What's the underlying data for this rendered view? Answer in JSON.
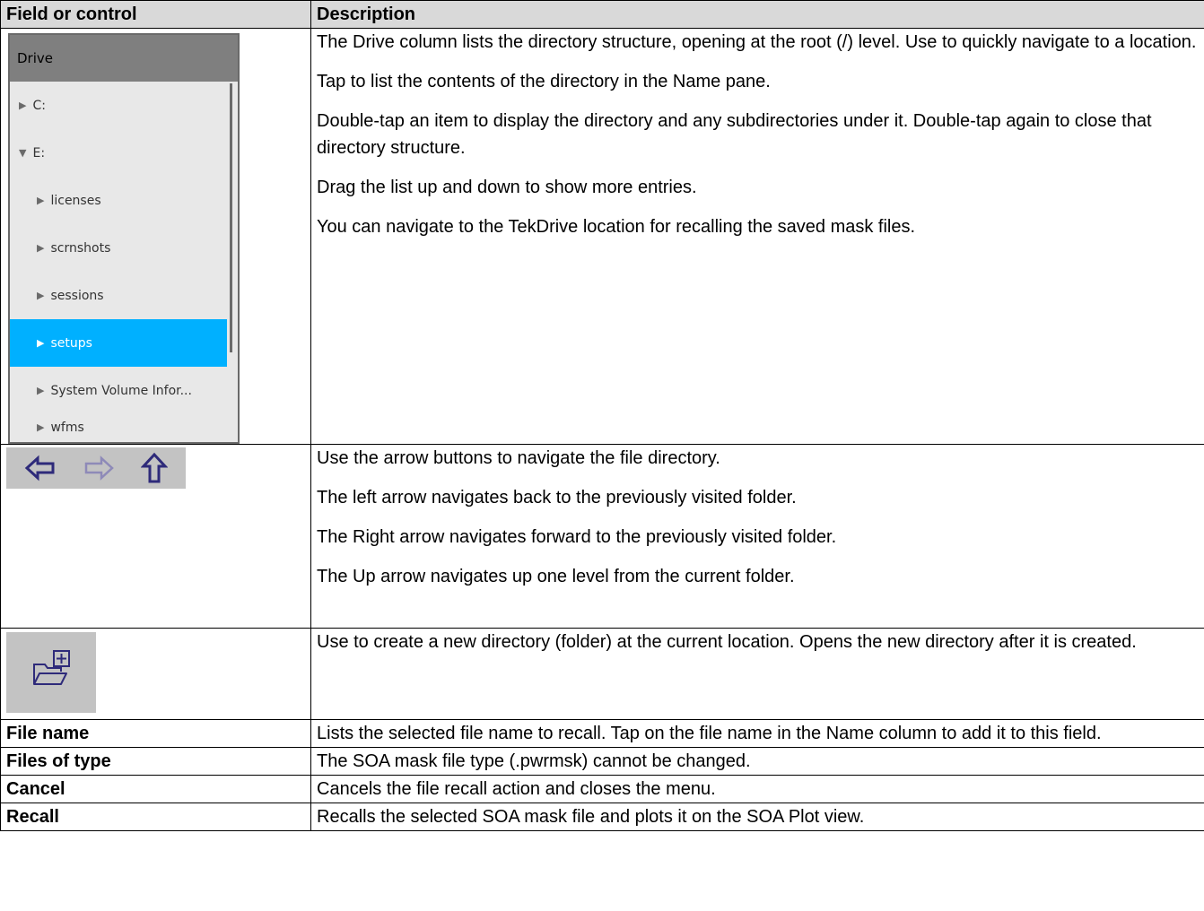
{
  "header": {
    "field": "Field or control",
    "description": "Description"
  },
  "drive_widget": {
    "title": "Drive",
    "items": [
      {
        "label": "C:",
        "expanded": false
      },
      {
        "label": "E:",
        "expanded": true
      },
      {
        "label": "licenses"
      },
      {
        "label": "scrnshots"
      },
      {
        "label": "sessions"
      },
      {
        "label": "setups",
        "selected": true
      },
      {
        "label": "System Volume Infor..."
      },
      {
        "label": "wfms"
      }
    ],
    "selected_color": "#00b0ff"
  },
  "rows": {
    "drive": {
      "paragraphs": [
        "The Drive column lists the directory structure, opening at the root (/) level. Use to quickly navigate to a location.",
        "Tap to list the contents of the directory in the Name pane.",
        "Double-tap an item to display the directory and any subdirectories under it. Double-tap again to close that directory structure.",
        "Drag the list up and down to show more entries.",
        "You can navigate to the TekDrive location for recalling the saved mask files."
      ]
    },
    "arrows": {
      "icons": [
        "back-arrow-icon",
        "forward-arrow-icon",
        "up-arrow-icon"
      ],
      "paragraphs": [
        "Use the arrow buttons to navigate the file directory.",
        "The left arrow navigates back to the previously visited folder.",
        "The Right arrow navigates forward to the previously visited folder.",
        "The Up arrow navigates up one level from the current folder."
      ]
    },
    "new_folder": {
      "icon": "new-folder-icon",
      "paragraphs": [
        "Use to create a new directory (folder) at the current location. Opens the new directory after it is created."
      ]
    },
    "file_name": {
      "field": "File name",
      "description": "Lists the selected file name to recall. Tap on the file name in the Name column to add it to this field."
    },
    "files_of_type": {
      "field": "Files of type",
      "description": "The SOA mask file type (.pwrmsk) cannot be changed."
    },
    "cancel": {
      "field": "Cancel",
      "description": "Cancels the file recall action and closes the menu."
    },
    "recall": {
      "field": "Recall",
      "description": "Recalls the selected SOA mask file and plots it on the SOA Plot view."
    }
  }
}
